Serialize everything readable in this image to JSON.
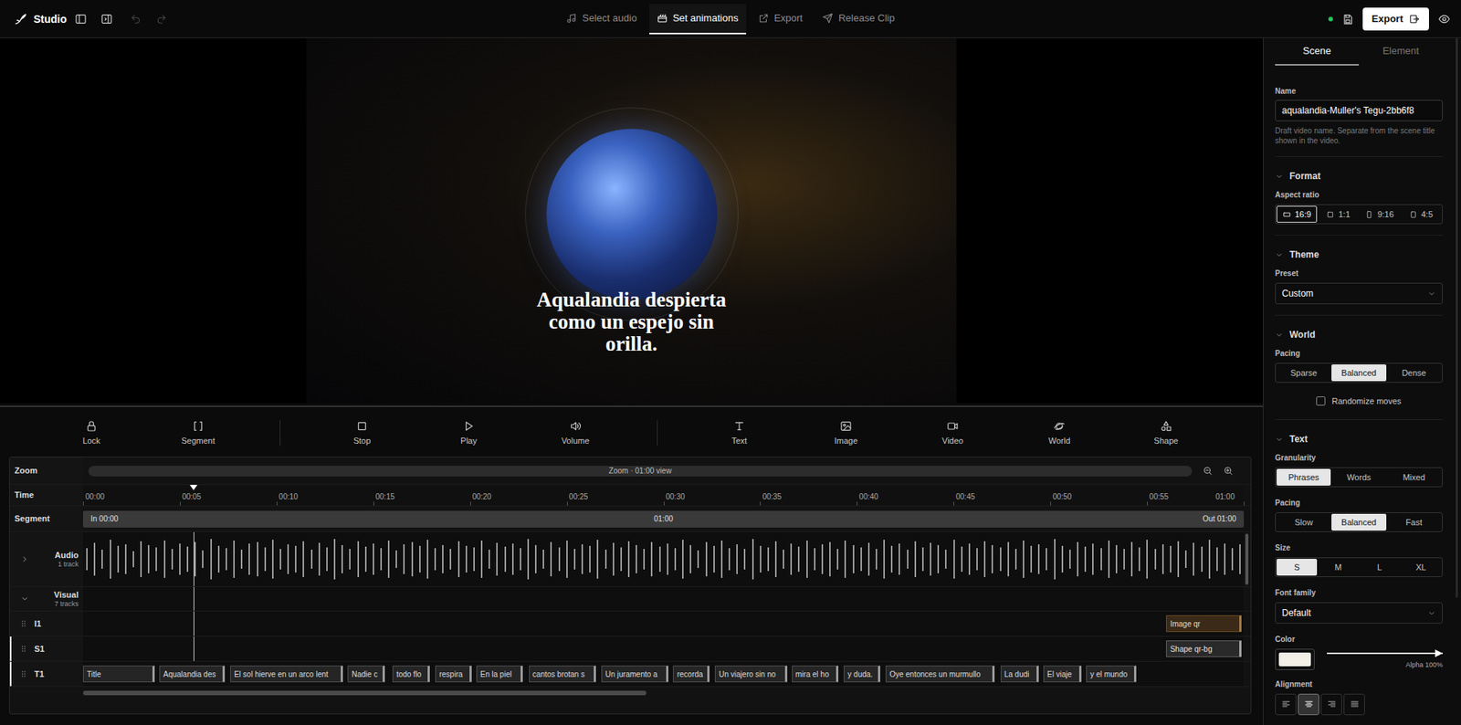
{
  "app": {
    "title": "Studio",
    "online": true
  },
  "history": {
    "undo_disabled": true,
    "redo_disabled": true
  },
  "steps": [
    {
      "label": "Select audio",
      "kind": "audio",
      "selected": false
    },
    {
      "label": "Set animations",
      "kind": "animations",
      "selected": true
    },
    {
      "label": "Export",
      "kind": "export",
      "selected": false
    },
    {
      "label": "Release Clip",
      "kind": "release",
      "selected": false
    }
  ],
  "export_button": "Export",
  "preview": {
    "caption": "Aqualandia despierta como un espejo sin orilla."
  },
  "toolbar": [
    [
      {
        "label": "Lock",
        "kind": "lock"
      },
      {
        "label": "Segment",
        "kind": "segment"
      }
    ],
    [
      {
        "label": "Stop",
        "kind": "stop"
      },
      {
        "label": "Play",
        "kind": "play"
      },
      {
        "label": "Volume",
        "kind": "volume"
      }
    ],
    [
      {
        "label": "Text",
        "kind": "text"
      },
      {
        "label": "Image",
        "kind": "image"
      },
      {
        "label": "Video",
        "kind": "video"
      },
      {
        "label": "World",
        "kind": "world"
      },
      {
        "label": "Shape",
        "kind": "shape"
      }
    ]
  ],
  "timeline": {
    "duration": 60,
    "zoom": {
      "label": "Zoom",
      "text": "Zoom · 01:00 view"
    },
    "time": {
      "label": "Time",
      "ticks": [
        "00:00",
        "00:05",
        "00:10",
        "00:15",
        "00:20",
        "00:25",
        "00:30",
        "00:35",
        "00:40",
        "00:45",
        "00:50",
        "00:55",
        "01:00"
      ]
    },
    "playhead": {
      "level": 0.0955
    },
    "segment": {
      "label": "Segment",
      "in": "In 00:00",
      "middle": "01:00",
      "out": "Out 01:00"
    },
    "audio": {
      "label": "Audio",
      "count": "1 track",
      "expanded": false,
      "waveform": [
        0.42,
        0.61,
        0.35,
        0.72,
        0.48,
        0.55,
        0.3,
        0.66,
        0.52,
        0.44,
        0.7,
        0.38,
        0.58,
        0.47,
        0.63,
        0.33,
        0.75,
        0.5,
        0.41,
        0.68,
        0.36,
        0.57,
        0.62,
        0.45,
        0.71,
        0.39,
        0.54,
        0.49,
        0.65,
        0.34,
        0.6,
        0.43,
        0.74,
        0.51,
        0.37,
        0.67,
        0.46,
        0.59,
        0.4,
        0.69,
        0.32,
        0.56,
        0.64,
        0.48,
        0.73,
        0.42,
        0.53,
        0.38,
        0.66,
        0.5,
        0.44,
        0.7,
        0.35,
        0.61,
        0.47,
        0.58,
        0.41,
        0.76,
        0.52,
        0.36,
        0.63,
        0.45,
        0.68,
        0.39,
        0.55,
        0.49,
        0.72,
        0.34,
        0.6,
        0.43,
        0.67,
        0.51,
        0.37,
        0.64,
        0.46,
        0.57,
        0.4,
        0.71,
        0.53,
        0.33,
        0.62,
        0.48,
        0.69,
        0.42,
        0.56,
        0.38,
        0.74,
        0.5,
        0.44,
        0.65,
        0.35,
        0.59,
        0.47,
        0.7,
        0.41,
        0.54,
        0.63,
        0.37,
        0.68,
        0.52,
        0.45,
        0.61,
        0.39,
        0.73,
        0.49,
        0.57,
        0.34,
        0.66,
        0.43,
        0.6,
        0.51,
        0.36,
        0.72,
        0.46,
        0.58,
        0.4,
        0.67,
        0.53,
        0.44,
        0.62,
        0.38,
        0.7,
        0.48,
        0.55,
        0.42,
        0.75,
        0.5,
        0.35,
        0.64,
        0.47,
        0.59,
        0.41,
        0.69,
        0.52,
        0.37,
        0.63,
        0.45,
        0.71,
        0.39,
        0.56,
        0.49,
        0.66,
        0.33,
        0.61,
        0.46,
        0.73,
        0.43,
        0.58,
        0.4,
        0.54
      ]
    },
    "visual": {
      "label": "Visual",
      "count": "7 tracks",
      "expanded": true
    },
    "tracks": [
      {
        "name": "I1",
        "selected": false,
        "clips": [
          {
            "label": "Image qr",
            "kind": "image",
            "start": 56.0,
            "end": 59.9
          }
        ]
      },
      {
        "name": "S1",
        "selected": true,
        "clips": [
          {
            "label": "Shape qr-bg",
            "kind": "shape",
            "start": 56.0,
            "end": 59.9
          }
        ]
      },
      {
        "name": "T1",
        "selected": true,
        "clips": [
          {
            "label": "Title",
            "kind": "text",
            "start": 0.0,
            "end": 3.71
          },
          {
            "label": "Aqualandia des",
            "kind": "text",
            "start": 3.95,
            "end": 7.33
          },
          {
            "label": "El sol hierve en un arco lent",
            "kind": "text",
            "start": 7.61,
            "end": 13.45
          },
          {
            "label": "Nadie c",
            "kind": "text",
            "start": 13.69,
            "end": 15.61
          },
          {
            "label": "todo flo",
            "kind": "text",
            "start": 16.0,
            "end": 17.93
          },
          {
            "label": "respira",
            "kind": "text",
            "start": 18.22,
            "end": 20.1
          },
          {
            "label": "En la piel",
            "kind": "text",
            "start": 20.34,
            "end": 22.75
          },
          {
            "label": "cantos brotan s",
            "kind": "text",
            "start": 23.04,
            "end": 26.51
          },
          {
            "label": "Un juramento a",
            "kind": "text",
            "start": 26.8,
            "end": 30.27
          },
          {
            "label": "recorda",
            "kind": "text",
            "start": 30.51,
            "end": 32.39
          },
          {
            "label": "Un viajero sin no",
            "kind": "text",
            "start": 32.67,
            "end": 36.39
          },
          {
            "label": "mira el ho",
            "kind": "text",
            "start": 36.63,
            "end": 39.04
          },
          {
            "label": "y duda.",
            "kind": "text",
            "start": 39.33,
            "end": 41.2
          },
          {
            "label": "Oye entonces un murmullo",
            "kind": "text",
            "start": 41.49,
            "end": 47.13
          },
          {
            "label": "La dudi",
            "kind": "text",
            "start": 47.42,
            "end": 49.4
          },
          {
            "label": "El viaje",
            "kind": "text",
            "start": 49.64,
            "end": 51.61
          },
          {
            "label": "y el mundo",
            "kind": "text",
            "start": 51.86,
            "end": 54.46
          }
        ]
      }
    ],
    "scrollbar": {
      "level": 0.485
    }
  },
  "panel": {
    "tabs": [
      {
        "label": "Scene",
        "selected": true
      },
      {
        "label": "Element",
        "selected": false
      }
    ],
    "name": {
      "label": "Name",
      "value": "aqualandia-Muller's Tegu-2bb6f8",
      "hint": "Draft video name. Separate from the scene title shown in the video."
    },
    "format": {
      "title": "Format",
      "expanded": true,
      "aspect": {
        "label": "Aspect ratio",
        "options": [
          {
            "label": "16:9",
            "kind": "landscape",
            "selected": true
          },
          {
            "label": "1:1",
            "kind": "square",
            "selected": false
          },
          {
            "label": "9:16",
            "kind": "portrait",
            "selected": false
          },
          {
            "label": "4:5",
            "kind": "tall",
            "selected": false
          }
        ]
      }
    },
    "theme": {
      "title": "Theme",
      "expanded": true,
      "preset": {
        "label": "Preset",
        "value": "Custom"
      }
    },
    "world": {
      "title": "World",
      "expanded": true,
      "pacing": {
        "label": "Pacing",
        "options": [
          {
            "label": "Sparse",
            "selected": false
          },
          {
            "label": "Balanced",
            "selected": true
          },
          {
            "label": "Dense",
            "selected": false
          }
        ]
      },
      "randomize": {
        "label": "Randomize moves",
        "checked": false
      }
    },
    "text": {
      "title": "Text",
      "expanded": true,
      "granularity": {
        "label": "Granularity",
        "options": [
          {
            "label": "Phrases",
            "selected": true
          },
          {
            "label": "Words",
            "selected": false
          },
          {
            "label": "Mixed",
            "selected": false
          }
        ]
      },
      "pacing": {
        "label": "Pacing",
        "options": [
          {
            "label": "Slow",
            "selected": false
          },
          {
            "label": "Balanced",
            "selected": true
          },
          {
            "label": "Fast",
            "selected": false
          }
        ]
      },
      "size": {
        "label": "Size",
        "options": [
          {
            "label": "S",
            "selected": true
          },
          {
            "label": "M",
            "selected": false
          },
          {
            "label": "L",
            "selected": false
          },
          {
            "label": "XL",
            "selected": false
          }
        ]
      },
      "font": {
        "label": "Font family",
        "value": "Default"
      },
      "color": {
        "label": "Color",
        "swatch": "#f3efe6",
        "alpha_level": 1,
        "alpha_text": "Alpha 100%"
      },
      "alignment": {
        "label": "Alignment",
        "options": [
          {
            "kind": "left",
            "selected": false
          },
          {
            "kind": "center",
            "selected": true
          },
          {
            "kind": "right",
            "selected": false
          },
          {
            "kind": "justify",
            "selected": false
          }
        ]
      }
    }
  }
}
